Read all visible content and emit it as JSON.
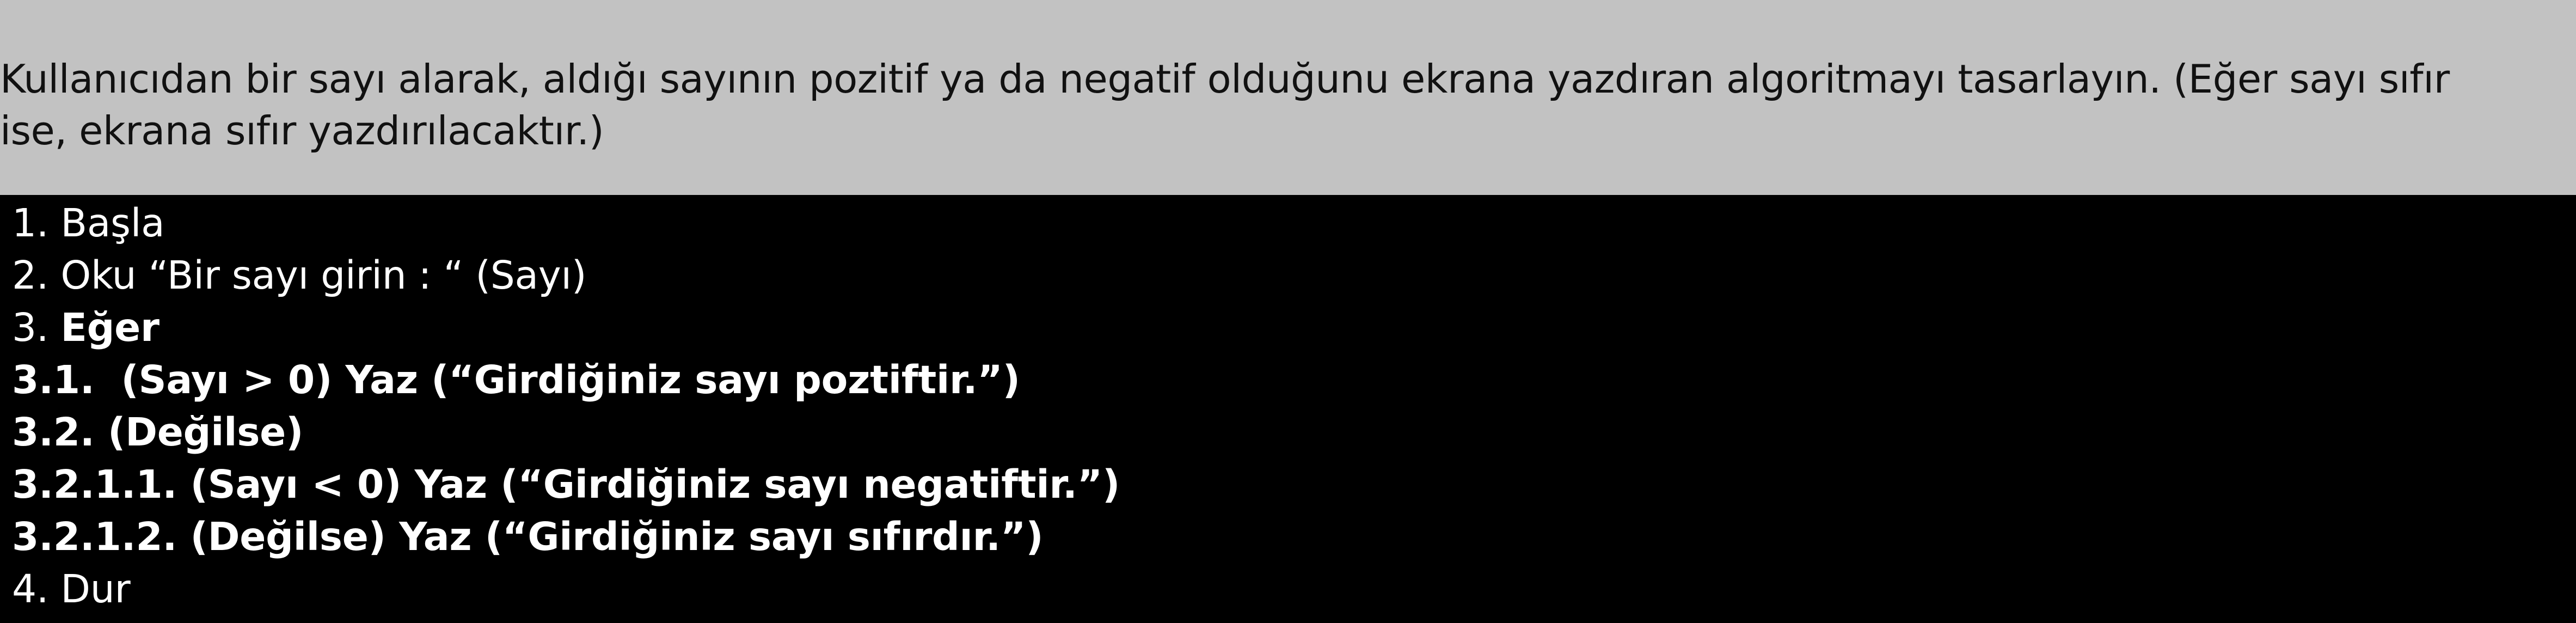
{
  "prompt": {
    "line1": "Kullanıcıdan bir sayı alarak, aldığı sayının pozitif ya da negatif olduğunu ekrana yazdıran algoritmayı tasarlayın. (Eğer sayı sıfır",
    "line2": "ise, ekrana sıfır yazdırılacaktır.)"
  },
  "colors": {
    "prompt_background": "#c2c2c2",
    "steps_background": "#000000",
    "steps_text": "#ffffff"
  },
  "steps": {
    "s1": "1. Başla",
    "s2": "2. Oku “Bir sayı girin : “ (Sayı)",
    "s3_prefix": "3. ",
    "s3_keyword": "Eğer",
    "s3_1": "3.1.  (Sayı > 0) Yaz (“Girdiğiniz sayı poztiftir.”)",
    "s3_2": "3.2. (Değilse)",
    "s3_2_1_1": "3.2.1.1. (Sayı < 0) Yaz (“Girdiğiniz sayı negatiftir.”)",
    "s3_2_1_2": "3.2.1.2. (Değilse) Yaz (“Girdiğiniz sayı sıfırdır.”)",
    "s4": "4. Dur"
  }
}
